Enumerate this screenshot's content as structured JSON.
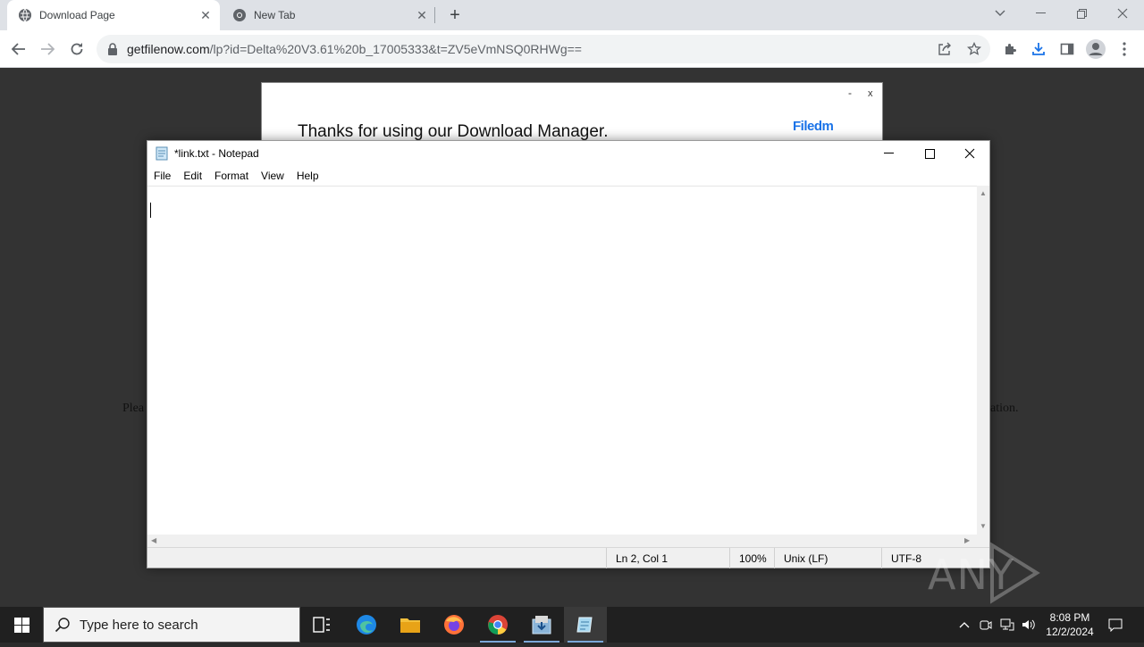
{
  "browser": {
    "tabs": [
      {
        "title": "Download Page",
        "active": true
      },
      {
        "title": "New Tab",
        "active": false
      }
    ],
    "url_host": "getfilenow.com",
    "url_path": "/lp?id=Delta%20V3.61%20b_17005333&t=ZV5eVmNSQ0RHWg=="
  },
  "page": {
    "left_fragment": "Plea",
    "right_fragment": "ation.",
    "banner": {
      "message": "Thanks for using our Download Manager.",
      "brand": "Filedm",
      "minimize": "-",
      "close": "x"
    }
  },
  "notepad": {
    "title": "*link.txt - Notepad",
    "menu": [
      "File",
      "Edit",
      "Format",
      "View",
      "Help"
    ],
    "status": {
      "position": "Ln 2, Col 1",
      "zoom": "100%",
      "line_ending": "Unix (LF)",
      "encoding": "UTF-8"
    }
  },
  "watermark": "ANY RUN",
  "taskbar": {
    "search_placeholder": "Type here to search",
    "time": "8:08 PM",
    "date": "12/2/2024"
  },
  "colors": {
    "page_bg": "#333333",
    "taskbar_bg": "#202020",
    "accent": "#1a73e8"
  }
}
